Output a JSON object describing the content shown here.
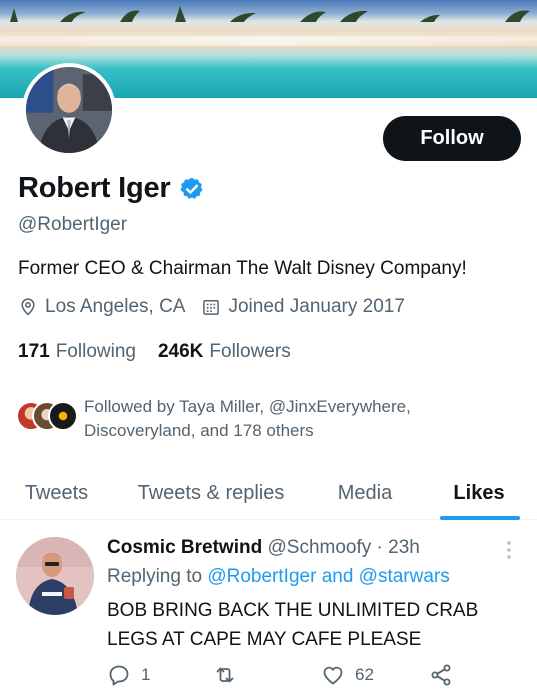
{
  "profile": {
    "name": "Robert Iger",
    "handle": "@RobertIger",
    "bio": "Former CEO & Chairman The Walt Disney Company!",
    "location": "Los Angeles, CA",
    "joined": "Joined January 2017",
    "follow_label": "Follow",
    "following_count": "171",
    "following_label": "Following",
    "followers_count": "246K",
    "followers_label": "Followers",
    "followed_by_text": "Followed by Taya Miller, @JinxEverywhere, Discoveryland, and 178 others"
  },
  "tabs": [
    {
      "label": "Tweets",
      "active": false
    },
    {
      "label": "Tweets & replies",
      "active": false
    },
    {
      "label": "Media",
      "active": false
    },
    {
      "label": "Likes",
      "active": true
    }
  ],
  "tweet": {
    "author_name": "Cosmic Bretwind",
    "author_handle": "@Schmoofy",
    "separator": "·",
    "time": "23h",
    "replying_to_prefix": "Replying to",
    "replying_to_user1": "@RobertIger",
    "replying_to_joiner": "and",
    "replying_to_user2": "@starwars",
    "text": "BOB BRING BACK THE UNLIMITED CRAB LEGS AT CAPE MAY CAFE PLEASE",
    "reply_count": "1",
    "retweet_count": "",
    "like_count": "62"
  },
  "icons": {
    "verified": "verified-badge-icon",
    "location": "location-pin-icon",
    "calendar": "calendar-icon",
    "reply": "reply-icon",
    "retweet": "retweet-icon",
    "like": "heart-icon",
    "share": "share-icon",
    "more": "more-vertical-icon"
  },
  "colors": {
    "accent": "#1d9bf0",
    "text": "#0f1419",
    "muted": "#536471",
    "follow_button_bg": "#0f1419"
  }
}
